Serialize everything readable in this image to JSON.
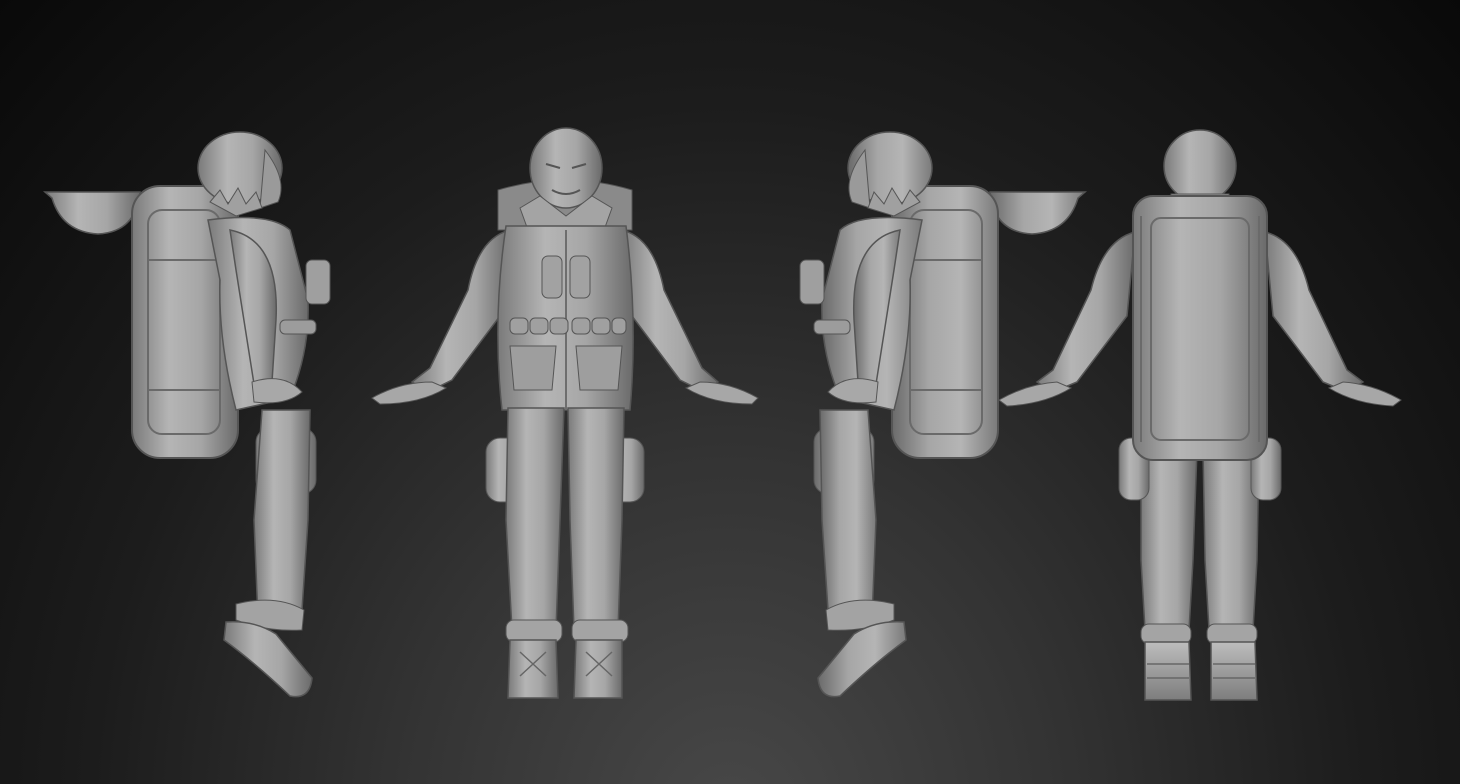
{
  "scene": {
    "background_colors": [
      "#484848",
      "#333333",
      "#1c1c1c",
      "#090909"
    ],
    "model_color": "#a9a9a9",
    "model_shadow_color": "#5c5c5c",
    "views": [
      {
        "name": "side-left",
        "icon": "figure-side-icon"
      },
      {
        "name": "front",
        "icon": "figure-front-icon"
      },
      {
        "name": "side-right",
        "icon": "figure-side-icon"
      },
      {
        "name": "back",
        "icon": "figure-back-icon"
      }
    ]
  }
}
